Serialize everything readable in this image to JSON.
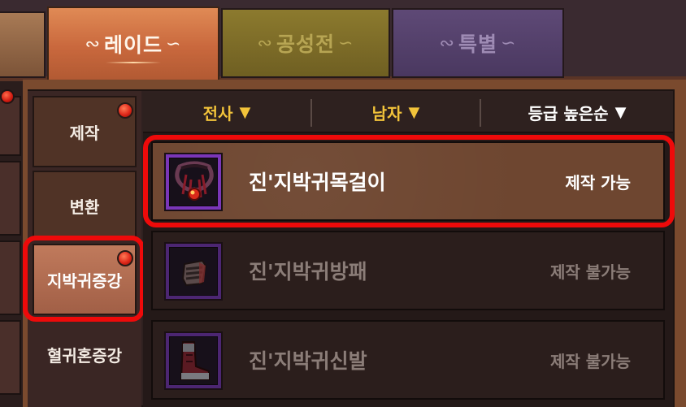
{
  "tabs": [
    {
      "label": "",
      "state": "partial"
    },
    {
      "label": "레이드",
      "state": "active"
    },
    {
      "label": "공성전",
      "state": "inactive"
    },
    {
      "label": "특별",
      "state": "inactive"
    }
  ],
  "ornament_left": "∾",
  "ornament_right": "∽",
  "side_menu": [
    {
      "label": "제작",
      "has_badge": true
    },
    {
      "label": "변환",
      "has_badge": false
    },
    {
      "label": "지박귀증강",
      "has_badge": true,
      "active": true
    },
    {
      "label": "혈귀혼증강",
      "has_badge": false
    }
  ],
  "filters": [
    {
      "label": "전사",
      "arrow": "▼"
    },
    {
      "label": "남자",
      "arrow": "▼"
    },
    {
      "label": "등급 높은순",
      "arrow": "▼"
    }
  ],
  "items": [
    {
      "name": "진'지박귀목걸이",
      "status": "제작 가능",
      "icon": "necklace-icon",
      "craftable": true
    },
    {
      "name": "진'지박귀방패",
      "status": "제작 불가능",
      "icon": "shield-icon",
      "craftable": false
    },
    {
      "name": "진'지박귀신발",
      "status": "제작 불가능",
      "icon": "boots-icon",
      "craftable": false
    }
  ],
  "colors": {
    "active_tab": "#c9683d",
    "siege_tab": "#6f5f22",
    "special_tab": "#4a3860",
    "filter_text": "#f2c33a",
    "highlight": "#ee0a0a",
    "item_frame": "#7a36b8"
  }
}
